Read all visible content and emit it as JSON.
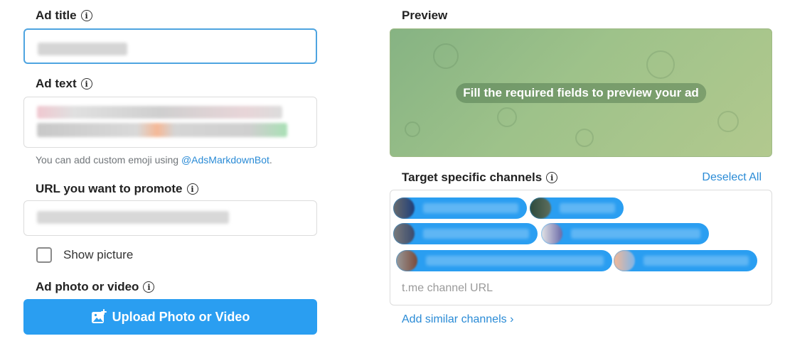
{
  "left": {
    "ad_title": {
      "label": "Ad title",
      "value": ""
    },
    "ad_text": {
      "label": "Ad text",
      "value": "",
      "hint_prefix": "You can add custom emoji using ",
      "hint_link": "@AdsMarkdownBot",
      "hint_suffix": "."
    },
    "url": {
      "label": "URL you want to promote",
      "value": ""
    },
    "show_picture": {
      "label": "Show picture",
      "checked": false
    },
    "media": {
      "label": "Ad photo or video",
      "button_label": "Upload Photo or Video"
    }
  },
  "right": {
    "preview": {
      "label": "Preview",
      "message": "Fill the required fields to preview your ad"
    },
    "channels": {
      "label": "Target specific channels",
      "deselect_all": "Deselect All",
      "input_placeholder": "t.me channel URL",
      "add_similar": "Add similar channels ›"
    }
  },
  "colors": {
    "accent": "#2a9ef1",
    "link": "#2a8bd6",
    "focus_border": "#4ea4e0"
  },
  "icons": {
    "info": "info-circle-icon",
    "upload": "add-photo-icon"
  }
}
